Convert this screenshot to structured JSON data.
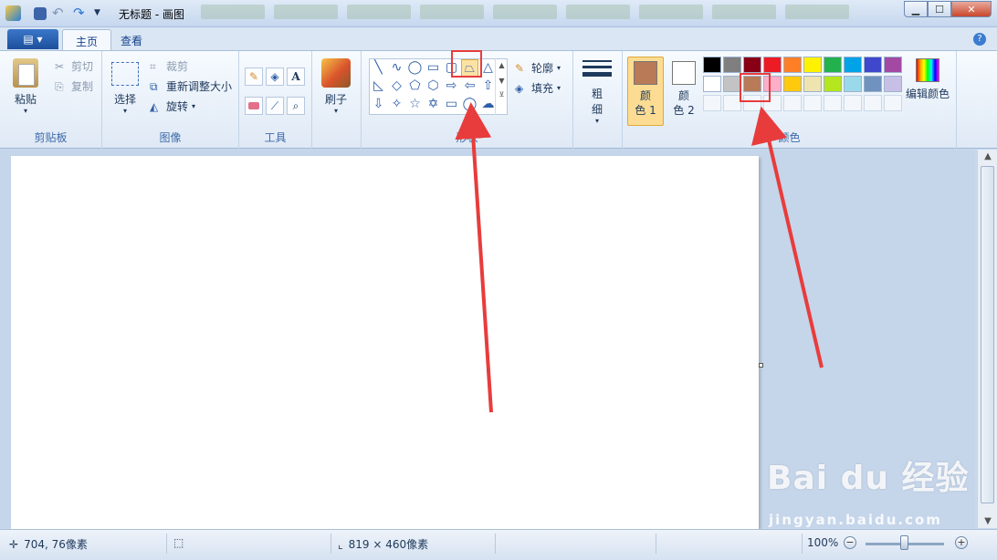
{
  "window": {
    "title": "无标题 - 画图"
  },
  "tabs": [
    {
      "label": "主页"
    },
    {
      "label": "查看"
    }
  ],
  "clipboard": {
    "group_label": "剪贴板",
    "paste": "粘贴",
    "cut": "剪切",
    "copy": "复制"
  },
  "image": {
    "group_label": "图像",
    "select": "选择",
    "crop": "裁剪",
    "resize": "重新调整大小",
    "rotate": "旋转"
  },
  "tools": {
    "group_label": "工具"
  },
  "brushes": {
    "label": "刷子"
  },
  "shapes": {
    "group_label": "形状",
    "outline": "轮廓",
    "fill": "填充",
    "items": [
      "line",
      "curve",
      "oval",
      "rectangle",
      "rounded-rectangle",
      "polygon",
      "triangle",
      "right-triangle",
      "diamond",
      "pentagon",
      "hexagon",
      "right-arrow",
      "left-arrow",
      "up-arrow",
      "down-arrow",
      "four-point-star",
      "five-point-star",
      "six-point-star",
      "rounded-callout",
      "oval-callout",
      "cloud-callout"
    ],
    "selected": "polygon"
  },
  "size": {
    "label_line1": "粗",
    "label_line2": "细"
  },
  "colors": {
    "group_label": "颜色",
    "color1_line1": "颜",
    "color1_line2": "色 1",
    "color2_line1": "颜",
    "color2_line2": "色 2",
    "color1_value": "#b97a57",
    "color2_value": "#ffffff",
    "edit": "编辑颜色",
    "palette_row1": [
      "#000000",
      "#7f7f7f",
      "#880015",
      "#ed1c24",
      "#ff7f27",
      "#fff200",
      "#22b14c",
      "#00a2e8",
      "#3f48cc",
      "#a349a4"
    ],
    "palette_row2": [
      "#ffffff",
      "#c3c3c3",
      "#b97a57",
      "#ffaec9",
      "#ffc90e",
      "#efe4b0",
      "#b5e61d",
      "#99d9ea",
      "#7092be",
      "#c8bfe7"
    ]
  },
  "status": {
    "cursor_pos": "704, 76像素",
    "canvas_size": "819 × 460像素",
    "zoom": "100%"
  },
  "watermark": {
    "main": "Bai du 经验",
    "url": "jingyan.baidu.com"
  }
}
